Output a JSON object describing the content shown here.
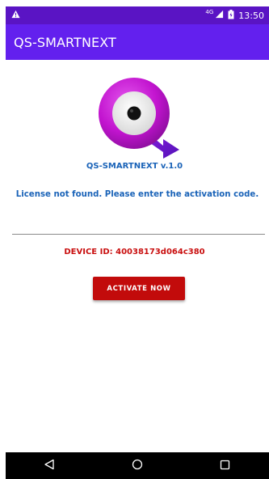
{
  "status_bar": {
    "time": "13:50",
    "network_label": "4G",
    "icons": [
      "alert-icon",
      "signal-icon",
      "battery-icon"
    ]
  },
  "app_bar": {
    "title": "QS-SMARTNEXT"
  },
  "main": {
    "logo_icon": "qs-smartnext-logo-icon",
    "version_text": "QS-SMARTNEXT v.1.0",
    "license_message": "License not found. Please enter the activation code.",
    "activation_input": {
      "value": "",
      "placeholder": ""
    },
    "device_id_label": "DEVICE ID: 40038173d064c380",
    "activate_button_label": "ACTIVATE NOW"
  },
  "nav_bar": {
    "icons": [
      "back-icon",
      "home-icon",
      "recents-icon"
    ]
  },
  "colors": {
    "status_bar": "#5a14c4",
    "app_bar": "#6320ee",
    "primary_text_blue": "#1a63b8",
    "accent_red": "#c20b0b",
    "logo_magenta": "#cc16d4",
    "logo_purple": "#6b1bd1"
  }
}
